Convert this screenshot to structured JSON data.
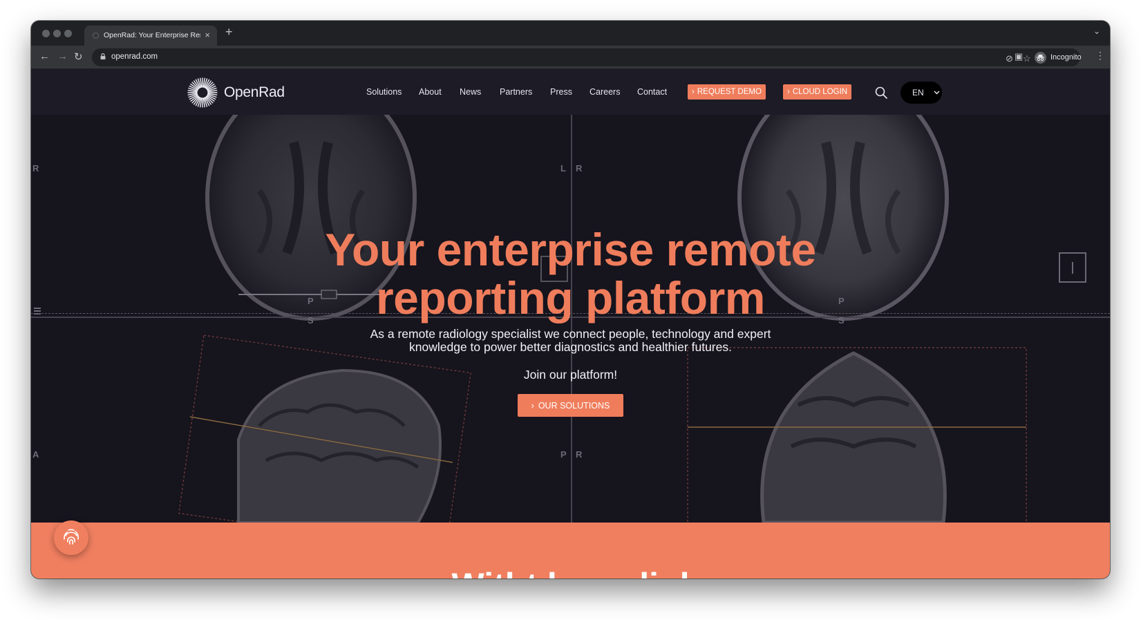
{
  "browser": {
    "tab_title": "OpenRad: Your Enterprise Rem",
    "url": "openrad.com",
    "incognito_label": "Incognito"
  },
  "site": {
    "logo_text": "OpenRad",
    "nav": [
      {
        "label": "Solutions"
      },
      {
        "label": "About"
      },
      {
        "label": "News"
      },
      {
        "label": "Partners"
      },
      {
        "label": "Press"
      },
      {
        "label": "Careers"
      },
      {
        "label": "Contact"
      }
    ],
    "request_demo": "REQUEST DEMO",
    "cloud_login": "CLOUD LOGIN",
    "language": "EN"
  },
  "hero": {
    "title_line1": "Your enterprise remote",
    "title_line2": "reporting platform",
    "subtitle_line1": "As a remote radiology specialist we connect people, technology and expert",
    "subtitle_line2": "knowledge to power better diagnostics and healthier futures.",
    "join": "Join our platform!",
    "button": "OUR SOLUTIONS",
    "scan_labels": [
      "R",
      "L",
      "R",
      "P",
      "S",
      "P",
      "S",
      "A",
      "P",
      "R"
    ]
  },
  "band": {
    "heading_fragment": "Witht ke radiol"
  },
  "colors": {
    "accent": "#ef7d5c",
    "nav_bg": "#1d1b26",
    "hero_bg": "#16141d"
  }
}
